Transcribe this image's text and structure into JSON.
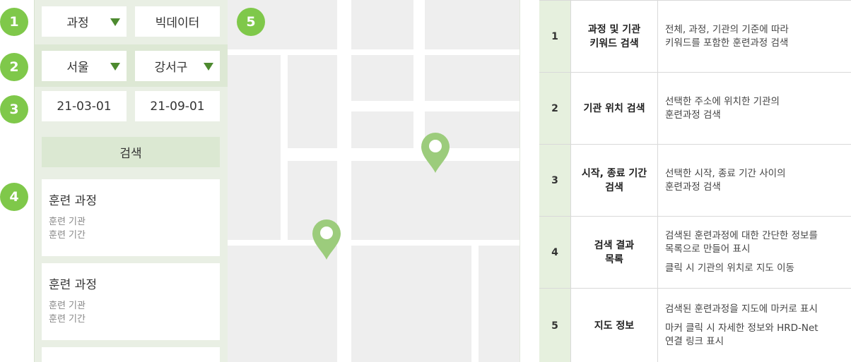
{
  "badges": [
    "1",
    "2",
    "3",
    "4",
    "5"
  ],
  "filters": {
    "category": "과정",
    "keyword": "빅데이터",
    "city": "서울",
    "district": "강서구",
    "start_date": "21-03-01",
    "end_date": "21-09-01",
    "search_label": "검색"
  },
  "results": [
    {
      "title": "훈련 과정",
      "institution": "훈련 기관",
      "period": "훈련 기간"
    },
    {
      "title": "훈련 과정",
      "institution": "훈련 기관",
      "period": "훈련 기간"
    }
  ],
  "colors": {
    "accent": "#7fc84a",
    "panel": "#e9efe4",
    "dropdown_arrow": "#4d8a2f",
    "pin": "#9ccc7c"
  },
  "table": [
    {
      "num": "1",
      "name_lines": [
        "과정 및 기관",
        "키워드 검색"
      ],
      "desc": [
        [
          "전체, 과정, 기관의 기준에 따라",
          "키워드를 포함한 훈련과정 검색"
        ]
      ]
    },
    {
      "num": "2",
      "name_lines": [
        "기관 위치 검색"
      ],
      "desc": [
        [
          "선택한 주소에 위치한 기관의",
          "훈련과정 검색"
        ]
      ]
    },
    {
      "num": "3",
      "name_lines": [
        "시작, 종료 기간",
        "검색"
      ],
      "desc": [
        [
          "선택한 시작, 종료 기간 사이의",
          "훈련과정 검색"
        ]
      ]
    },
    {
      "num": "4",
      "name_lines": [
        "검색 결과",
        "목록"
      ],
      "desc": [
        [
          "검색된 훈련과정에 대한 간단한 정보를",
          "목록으로 만들어 표시"
        ],
        [
          "클릭 시 기관의 위치로 지도 이동"
        ]
      ]
    },
    {
      "num": "5",
      "name_lines": [
        "지도 정보"
      ],
      "desc": [
        [
          "검색된 훈련과정을 지도에 마커로 표시"
        ],
        [
          "마커 클릭 시 자세한 정보와 HRD-Net",
          "연결 링크 표시"
        ]
      ]
    }
  ]
}
